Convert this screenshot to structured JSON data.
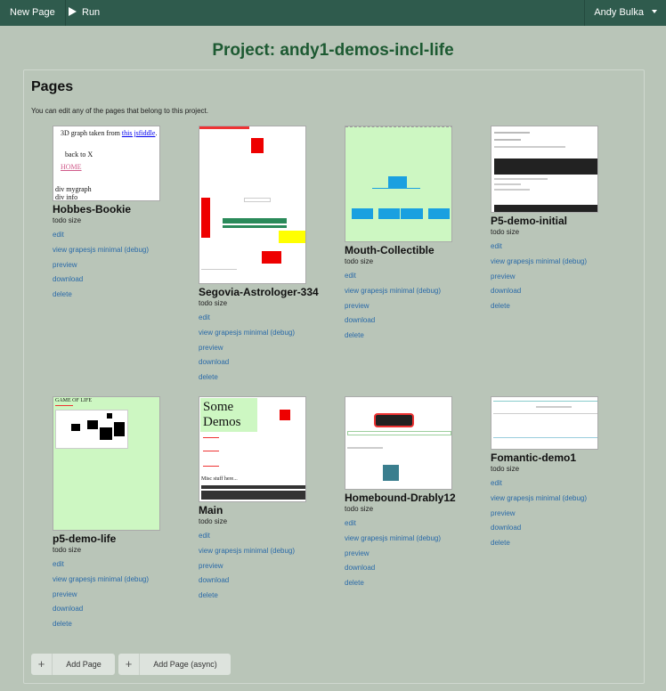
{
  "nav": {
    "new_page": "New Page",
    "run": "Run",
    "user": "Andy Bulka"
  },
  "project_title": "Project: andy1-demos-incl-life",
  "pages_heading": "Pages",
  "pages_description": "You can edit any of the pages that belong to this project.",
  "link_labels": {
    "edit": "edit",
    "debug": "view grapesjs minimal (debug)",
    "preview": "preview",
    "download": "download",
    "delete": "delete"
  },
  "pages": [
    {
      "title": "Hobbes-Bookie",
      "size": "todo size"
    },
    {
      "title": "Segovia-Astrologer-334",
      "size": "todo size"
    },
    {
      "title": "Mouth-Collectible",
      "size": "todo size"
    },
    {
      "title": "P5-demo-initial",
      "size": "todo size"
    },
    {
      "title": "p5-demo-life",
      "size": "todo size"
    },
    {
      "title": "Main",
      "size": "todo size"
    },
    {
      "title": "Homebound-Drably12",
      "size": "todo size"
    },
    {
      "title": "Fomantic-demo1",
      "size": "todo size"
    }
  ],
  "thumb_text": {
    "hobbes_line1": "3D graph taken from",
    "hobbes_link": "this jsfiddle",
    "hobbes_line2": "back to X",
    "hobbes_home": "HOME",
    "hobbes_line3": "div mygraph",
    "hobbes_line4": "div info",
    "life_title": "GAME OF LIFE",
    "main_heading": "Some Demos",
    "main_misc": "Misc stuff here..."
  },
  "buttons": {
    "add_page": "Add Page",
    "add_page_async": "Add Page (async)"
  },
  "colors": {
    "navbar": "#2f5b4d",
    "background": "#b9c5b8",
    "title": "#1d5a32",
    "link": "#2a6aa8"
  }
}
